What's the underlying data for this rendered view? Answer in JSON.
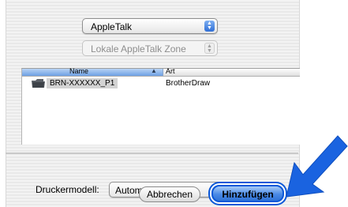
{
  "zone_type": {
    "selected": "AppleTalk"
  },
  "zone": {
    "selected": "Lokale AppleTalk Zone"
  },
  "printer_list": {
    "columns": [
      "Name",
      "Art"
    ],
    "rows": [
      {
        "name": "BRN-XXXXXX_P1",
        "kind": "BrotherDraw"
      }
    ]
  },
  "printer_model": {
    "label": "Druckermodell:",
    "selected": "Automatisch..."
  },
  "buttons": {
    "cancel": "Abbrechen",
    "add": "Hinzufügen"
  },
  "colors": {
    "accent": "#0b58d8",
    "callout_arrow": "#1a63e0"
  }
}
